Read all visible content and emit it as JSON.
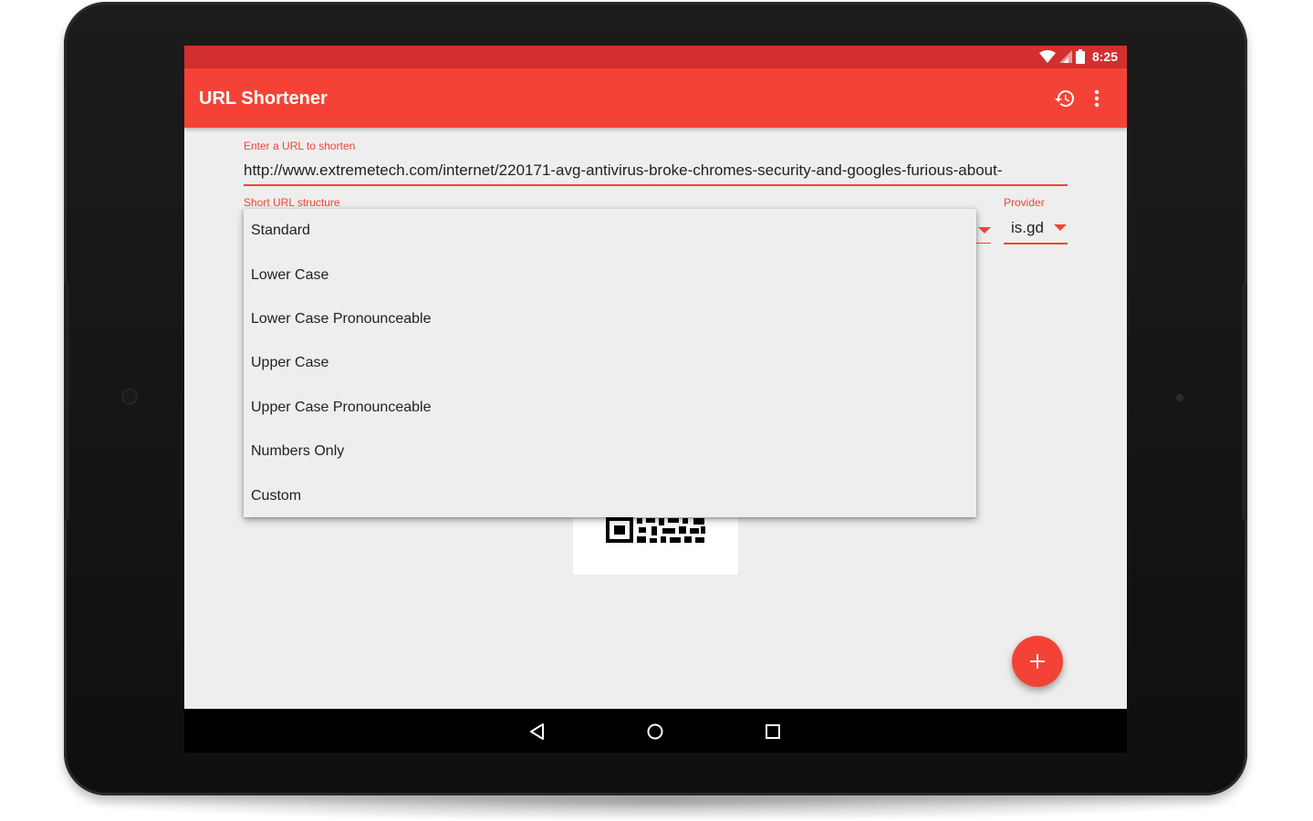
{
  "status_bar": {
    "time": "8:25"
  },
  "app_bar": {
    "title": "URL Shortener",
    "history_icon": "history-icon",
    "overflow_icon": "more-vert-icon"
  },
  "form": {
    "url_label": "Enter a URL to shorten",
    "url_value": "http://www.extremetech.com/internet/220171-avg-antivirus-broke-chromes-security-and-googles-furious-about-",
    "structure_label": "Short URL structure",
    "provider_label": "Provider",
    "provider_value": "is.gd"
  },
  "dropdown": {
    "options": [
      "Standard",
      "Lower Case",
      "Lower Case Pronounceable",
      "Upper Case",
      "Upper Case Pronounceable",
      "Numbers Only",
      "Custom"
    ]
  },
  "fab": {
    "label": "+"
  },
  "colors": {
    "primary": "#f44336",
    "primary_dark": "#d32f2f",
    "background": "#eeeeee"
  }
}
